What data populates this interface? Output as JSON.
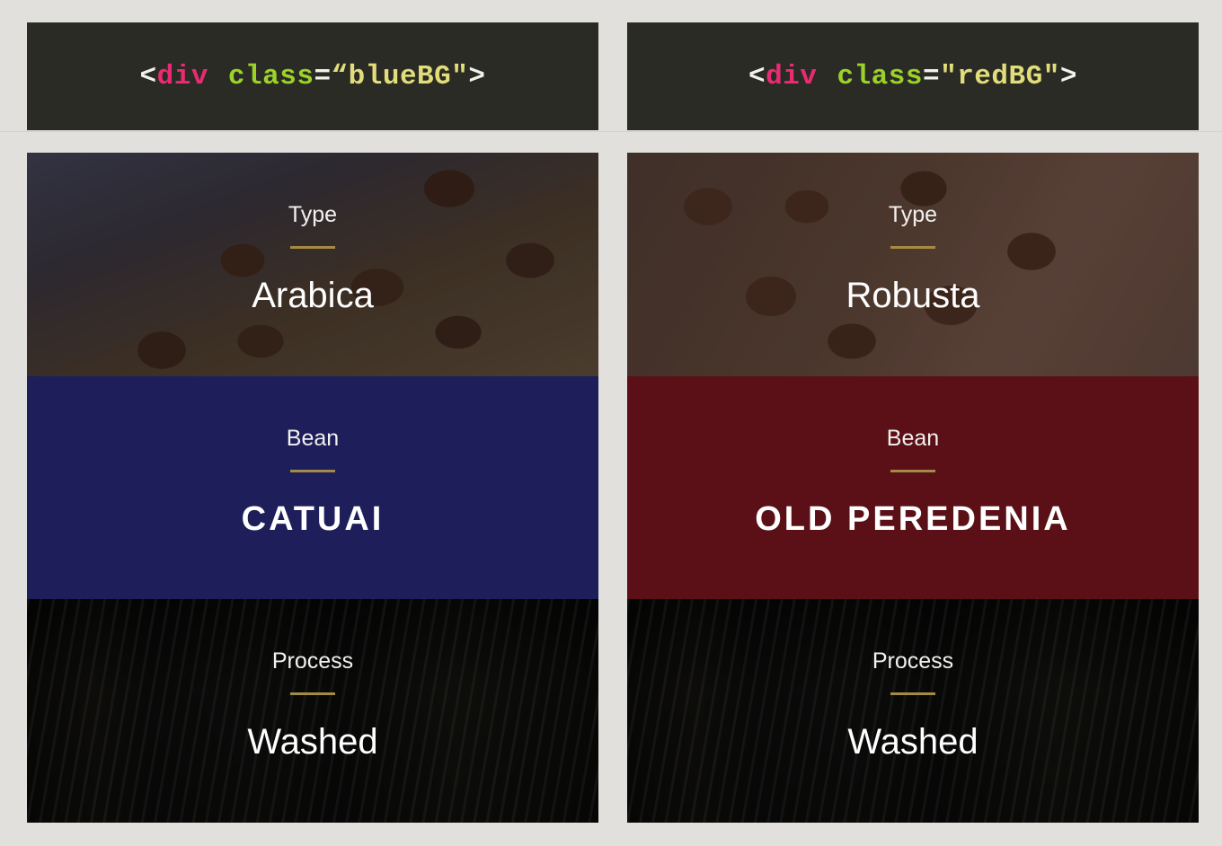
{
  "code_left": {
    "open": "<",
    "tag": "div",
    "attr": "class",
    "eq": "=",
    "value": "“blueBG\"",
    "close": ">"
  },
  "code_right": {
    "open": "<",
    "tag": "div",
    "attr": "class",
    "eq": "=",
    "value": "\"redBG\"",
    "close": ">"
  },
  "cards": {
    "blue": {
      "accent": "#1d1e5a",
      "type_label": "Type",
      "type_value": "Arabica",
      "bean_label": "Bean",
      "bean_value": "CATUAI",
      "process_label": "Process",
      "process_value": "Washed"
    },
    "red": {
      "accent": "#5a1016",
      "type_label": "Type",
      "type_value": "Robusta",
      "bean_label": "Bean",
      "bean_value": "OLD PEREDENIA",
      "process_label": "Process",
      "process_value": "Washed"
    }
  },
  "colors": {
    "rule": "#a48b45",
    "code_bg": "#2a2b25",
    "tag": "#ea2a72",
    "attr": "#9bd22a",
    "string": "#e3dc7a"
  }
}
